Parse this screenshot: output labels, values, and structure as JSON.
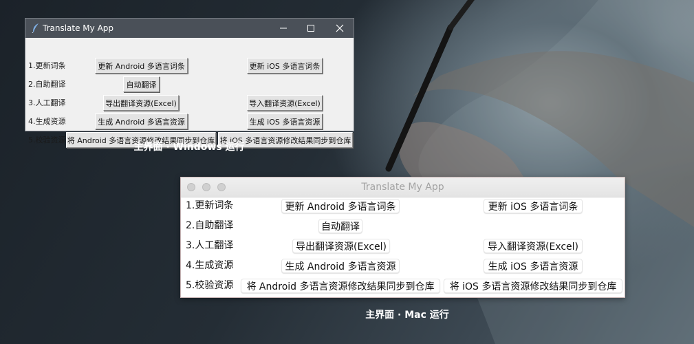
{
  "windows_app": {
    "title": "Translate My App",
    "rows": [
      {
        "label": "1.更新词条",
        "buttons": [
          "更新 Android 多语言词条",
          "更新 iOS 多语言词条"
        ]
      },
      {
        "label": "2.自助翻译",
        "buttons": [
          "自动翻译"
        ]
      },
      {
        "label": "3.人工翻译",
        "buttons": [
          "导出翻译资源(Excel)",
          "导入翻译资源(Excel)"
        ]
      },
      {
        "label": "4.生成资源",
        "buttons": [
          "生成 Android 多语言资源",
          "生成 iOS 多语言资源"
        ]
      },
      {
        "label": "5.校验资源",
        "buttons": [
          "将 Android 多语言资源修改结果同步到仓库",
          "将 iOS 多语言资源修改结果同步到仓库"
        ]
      }
    ],
    "caption": "主界面 · Windows 运行"
  },
  "mac_app": {
    "title": "Translate My App",
    "rows": [
      {
        "label": "1.更新词条",
        "buttons": [
          "更新 Android 多语言词条",
          "更新 iOS 多语言词条"
        ]
      },
      {
        "label": "2.自助翻译",
        "buttons": [
          "自动翻译"
        ]
      },
      {
        "label": "3.人工翻译",
        "buttons": [
          "导出翻译资源(Excel)",
          "导入翻译资源(Excel)"
        ]
      },
      {
        "label": "4.生成资源",
        "buttons": [
          "生成 Android 多语言资源",
          "生成 iOS 多语言资源"
        ]
      },
      {
        "label": "5.校验资源",
        "buttons": [
          "将 Android 多语言资源修改结果同步到仓库",
          "将 iOS 多语言资源修改结果同步到仓库"
        ]
      }
    ],
    "caption": "主界面 · Mac 运行"
  },
  "colors": {
    "windows_titlebar": "#4a5058",
    "windows_body": "#f0f0f0",
    "mac_body": "#ffffff",
    "caption_text": "#ffffff"
  }
}
